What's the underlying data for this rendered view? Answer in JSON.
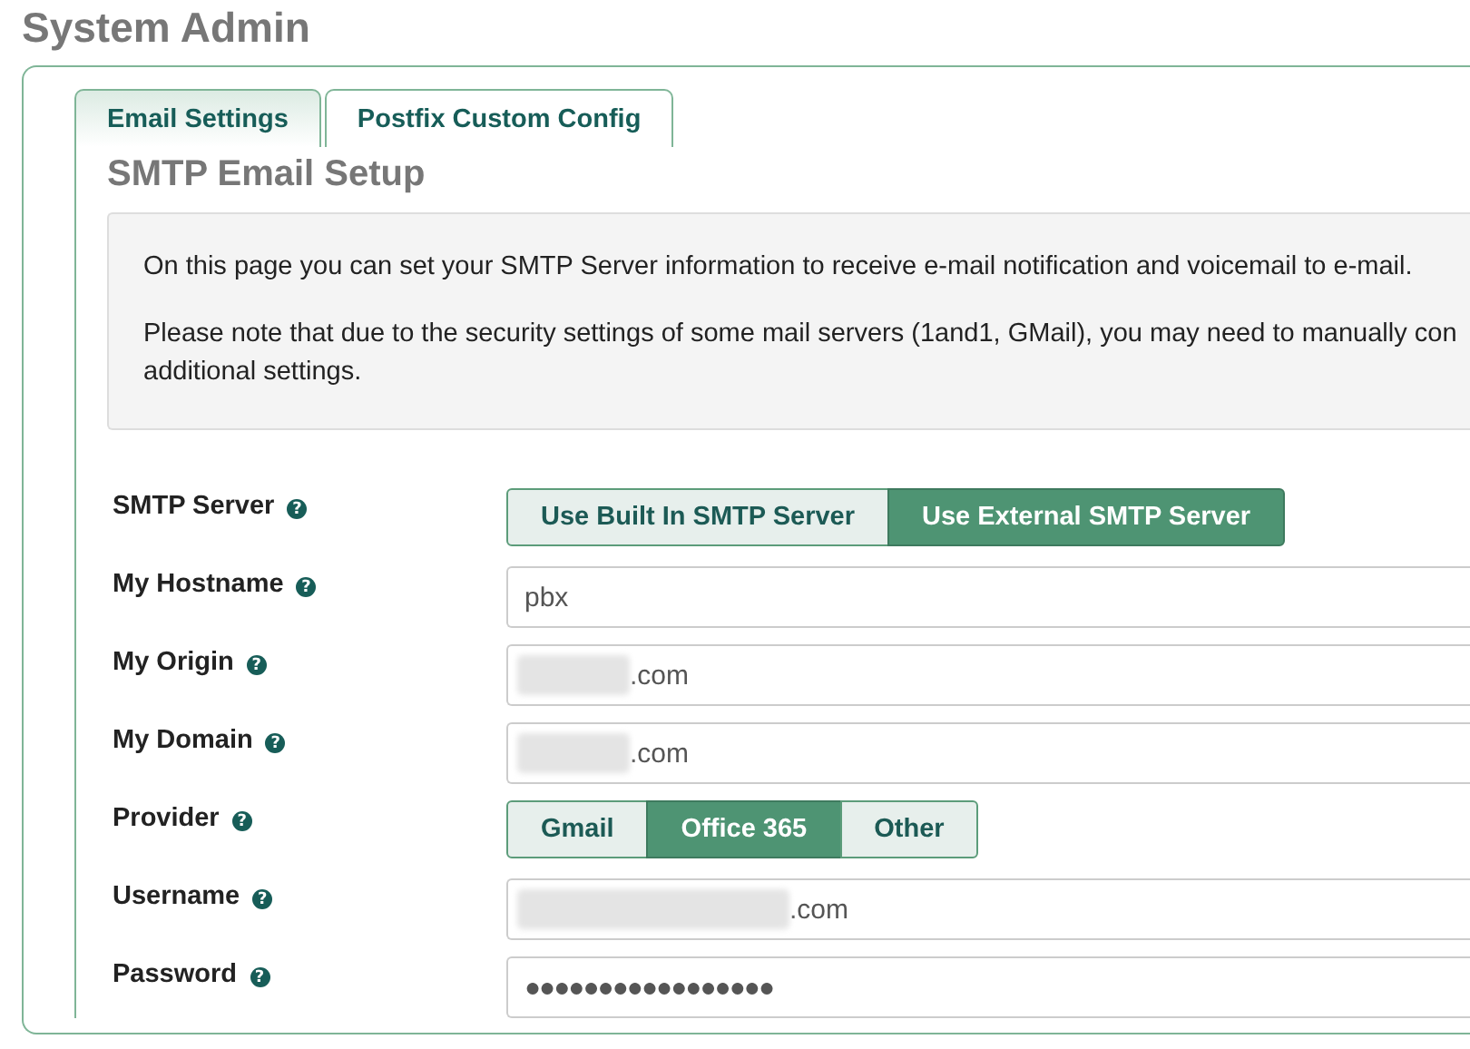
{
  "page_title": "System Admin",
  "tabs": [
    {
      "label": "Email Settings",
      "selected": true
    },
    {
      "label": "Postfix Custom Config",
      "selected": false
    }
  ],
  "section_title": "SMTP Email Setup",
  "info": {
    "paragraphs": [
      [
        "On this page you can set your SMTP Server information to receive e-mail notification and voicemail to e-mail."
      ],
      [
        "Please note that due to the security settings of some mail servers (1and1, GMail), you may need to manually con",
        "additional settings."
      ]
    ]
  },
  "fields": [
    {
      "label": "SMTP Server",
      "help": "?",
      "kind": "toggle",
      "options": [
        {
          "label": "Use Built In SMTP Server",
          "selected": false
        },
        {
          "label": "Use External SMTP Server",
          "selected": true
        }
      ]
    },
    {
      "label": "My Hostname",
      "help": "?",
      "kind": "text",
      "value": "pbx",
      "redacted": false
    },
    {
      "label": "My Origin",
      "help": "?",
      "kind": "text",
      "value": ".com",
      "redacted": true,
      "redact_wide": false
    },
    {
      "label": "My Domain",
      "help": "?",
      "kind": "text",
      "value": ".com",
      "redacted": true,
      "redact_wide": false
    },
    {
      "label": "Provider",
      "help": "?",
      "kind": "toggle",
      "options": [
        {
          "label": "Gmail",
          "selected": false
        },
        {
          "label": "Office 365",
          "selected": true
        },
        {
          "label": "Other",
          "selected": false
        }
      ]
    },
    {
      "label": "Username",
      "help": "?",
      "kind": "text",
      "value": ".com",
      "redacted": true,
      "redact_wide": true
    },
    {
      "label": "Password",
      "help": "?",
      "kind": "password",
      "value": "●●●●●●●●●●●●●●●●●"
    }
  ]
}
